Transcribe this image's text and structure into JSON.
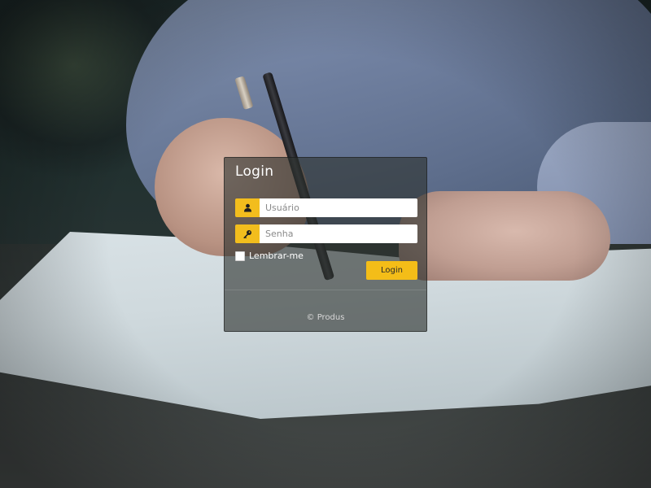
{
  "login": {
    "title": "Login",
    "username": {
      "placeholder": "Usuário",
      "value": "",
      "icon": "user-icon"
    },
    "password": {
      "placeholder": "Senha",
      "value": "",
      "icon": "key-icon"
    },
    "remember_label": "Lembrar-me",
    "remember_checked": false,
    "submit_label": "Login",
    "footer": "© Produs"
  },
  "colors": {
    "accent": "#f4bd18",
    "panel": "#2d322f",
    "input_bg": "#ffffff"
  }
}
